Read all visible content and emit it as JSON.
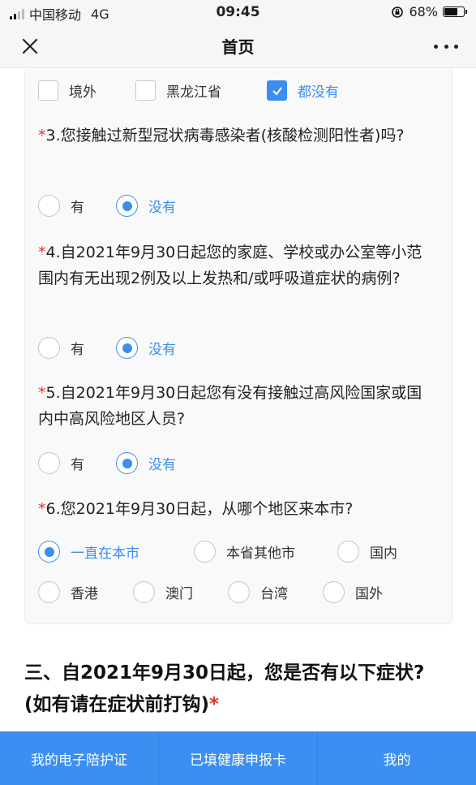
{
  "status_bar": {
    "carrier": "中国移动",
    "network": "4G",
    "time": "09:45",
    "battery": "68%",
    "battery_level": 0.68
  },
  "nav": {
    "title": "首页",
    "close_icon": "close-icon",
    "more_icon": "more-icon"
  },
  "q2_options": [
    {
      "label": "境外",
      "checked": false
    },
    {
      "label": "黑龙江省",
      "checked": false
    },
    {
      "label": "都没有",
      "checked": true
    }
  ],
  "q3": {
    "star": "*",
    "text": "3.您接触过新型冠状病毒感染者(核酸检测阳性者)吗?",
    "options": [
      "有",
      "没有"
    ],
    "selected": "没有"
  },
  "q4": {
    "star": "*",
    "text": "4.自2021年9月30日起您的家庭、学校或办公室等小范围内有无出现2例及以上发热和/或呼吸道症状的病例?",
    "options": [
      "有",
      "没有"
    ],
    "selected": "没有"
  },
  "q5": {
    "star": "*",
    "text": "5.自2021年9月30日起您有没有接触过高风险国家或国内中高风险地区人员?",
    "options": [
      "有",
      "没有"
    ],
    "selected": "没有"
  },
  "q6": {
    "star": "*",
    "text": "6.您2021年9月30日起，从哪个地区来本市?",
    "options": [
      "一直在本市",
      "本省其他市",
      "国内",
      "香港",
      "澳门",
      "台湾",
      "国外"
    ],
    "selected": "一直在本市"
  },
  "section3": {
    "text": "三、自2021年9月30日起，您是否有以下症状? (如有请在症状前打钩)",
    "star": "*"
  },
  "tabs": [
    "我的电子陪护证",
    "已填健康申报卡",
    "我的"
  ],
  "colors": {
    "accent": "#3a8ff0",
    "required": "#e5352b"
  }
}
